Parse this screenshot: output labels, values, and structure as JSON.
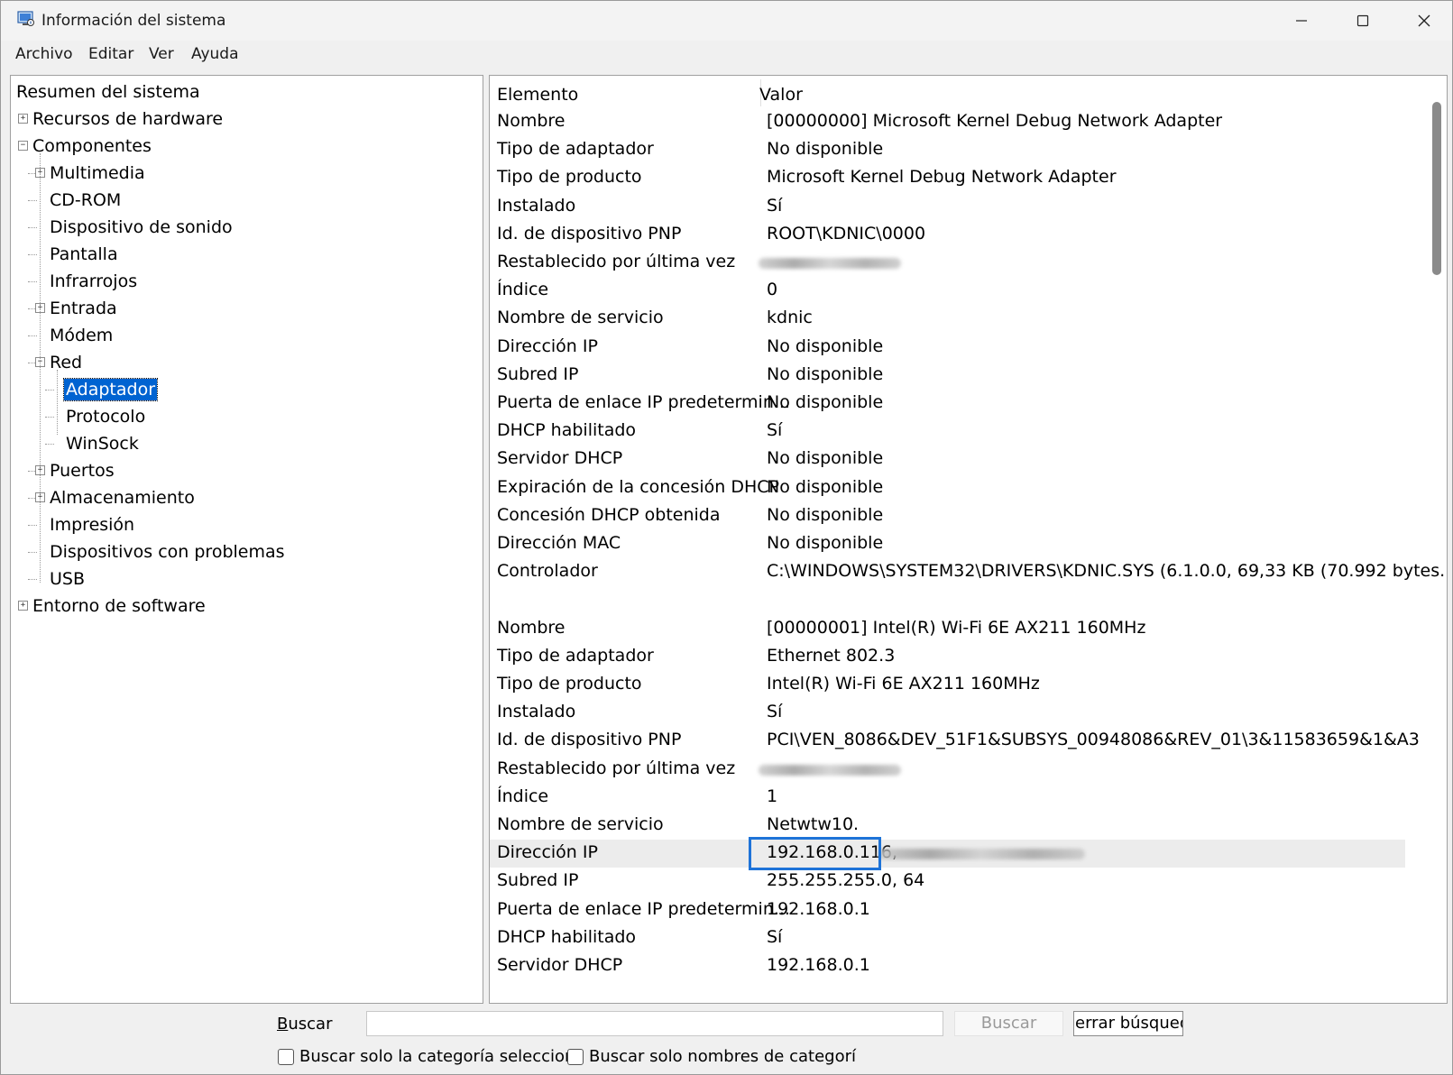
{
  "window": {
    "title": "Información del sistema"
  },
  "menu": [
    "Archivo",
    "Editar",
    "Ver",
    "Ayuda"
  ],
  "tree": {
    "items": [
      {
        "label": "Resumen del sistema",
        "level": 0,
        "expander": "none"
      },
      {
        "label": "Recursos de hardware",
        "level": 0,
        "expander": "plus"
      },
      {
        "label": "Componentes",
        "level": 0,
        "expander": "minus"
      },
      {
        "label": "Multimedia",
        "level": 1,
        "expander": "plus"
      },
      {
        "label": "CD-ROM",
        "level": 1,
        "expander": "none"
      },
      {
        "label": "Dispositivo de sonido",
        "level": 1,
        "expander": "none"
      },
      {
        "label": "Pantalla",
        "level": 1,
        "expander": "none"
      },
      {
        "label": "Infrarrojos",
        "level": 1,
        "expander": "none"
      },
      {
        "label": "Entrada",
        "level": 1,
        "expander": "plus"
      },
      {
        "label": "Módem",
        "level": 1,
        "expander": "none"
      },
      {
        "label": "Red",
        "level": 1,
        "expander": "minus"
      },
      {
        "label": "Adaptador",
        "level": 2,
        "expander": "none",
        "selected": true
      },
      {
        "label": "Protocolo",
        "level": 2,
        "expander": "none"
      },
      {
        "label": "WinSock",
        "level": 2,
        "expander": "none"
      },
      {
        "label": "Puertos",
        "level": 1,
        "expander": "plus"
      },
      {
        "label": "Almacenamiento",
        "level": 1,
        "expander": "plus"
      },
      {
        "label": "Impresión",
        "level": 1,
        "expander": "none"
      },
      {
        "label": "Dispositivos con problemas",
        "level": 1,
        "expander": "none"
      },
      {
        "label": "USB",
        "level": 1,
        "expander": "none"
      },
      {
        "label": "Entorno de software",
        "level": 0,
        "expander": "plus"
      }
    ]
  },
  "list": {
    "headers": {
      "key": "Elemento",
      "value": "Valor"
    },
    "rows": [
      {
        "k": "Nombre",
        "v": "[00000000] Microsoft Kernel Debug Network Adapter"
      },
      {
        "k": "Tipo de adaptador",
        "v": "No disponible"
      },
      {
        "k": "Tipo de producto",
        "v": "Microsoft Kernel Debug Network Adapter"
      },
      {
        "k": "Instalado",
        "v": "Sí"
      },
      {
        "k": "Id. de dispositivo PNP",
        "v": "ROOT\\KDNIC\\0000"
      },
      {
        "k": "Restablecido por última vez",
        "v": "",
        "redacted": true
      },
      {
        "k": "Índice",
        "v": "0"
      },
      {
        "k": "Nombre de servicio",
        "v": "kdnic"
      },
      {
        "k": "Dirección IP",
        "v": "No disponible"
      },
      {
        "k": "Subred IP",
        "v": "No disponible"
      },
      {
        "k": "Puerta de enlace IP predetermin...",
        "v": "No disponible"
      },
      {
        "k": "DHCP habilitado",
        "v": "Sí"
      },
      {
        "k": "Servidor DHCP",
        "v": "No disponible"
      },
      {
        "k": "Expiración de la concesión DHCP",
        "v": "No disponible"
      },
      {
        "k": "Concesión DHCP obtenida",
        "v": "No disponible"
      },
      {
        "k": "Dirección MAC",
        "v": "No disponible"
      },
      {
        "k": "Controlador",
        "v": "C:\\WINDOWS\\SYSTEM32\\DRIVERS\\KDNIC.SYS (6.1.0.0, 69,33 KB (70.992 bytes..."
      },
      {
        "k": "",
        "v": ""
      },
      {
        "k": "Nombre",
        "v": "[00000001] Intel(R) Wi-Fi 6E AX211 160MHz"
      },
      {
        "k": "Tipo de adaptador",
        "v": "Ethernet 802.3"
      },
      {
        "k": "Tipo de producto",
        "v": "Intel(R) Wi-Fi 6E AX211 160MHz"
      },
      {
        "k": "Instalado",
        "v": "Sí"
      },
      {
        "k": "Id. de dispositivo PNP",
        "v": "PCI\\VEN_8086&DEV_51F1&SUBSYS_00948086&REV_01\\3&11583659&1&A3"
      },
      {
        "k": "Restablecido por última vez",
        "v": "",
        "redacted": true
      },
      {
        "k": "Índice",
        "v": "1"
      },
      {
        "k": "Nombre de servicio",
        "v": "Netwtw10."
      },
      {
        "k": "Dirección IP",
        "v": "192.168.0.116,",
        "redacted_tail": true,
        "highlight": true,
        "boxed": true
      },
      {
        "k": "Subred IP",
        "v": "255.255.255.0, 64"
      },
      {
        "k": "Puerta de enlace IP predetermin...",
        "v": "192.168.0.1"
      },
      {
        "k": "DHCP habilitado",
        "v": "Sí"
      },
      {
        "k": "Servidor DHCP",
        "v": "192.168.0.1"
      }
    ]
  },
  "search": {
    "label_prefix": "",
    "label_underlined": "B",
    "label_rest": "uscar",
    "input_value": "",
    "find_button": "Buscar",
    "close_button": "errar búsqued",
    "checkbox1": "Buscar solo la categoría seleccion",
    "checkbox2": "Buscar solo nombres de categorí"
  },
  "colors": {
    "selection": "#0063d1",
    "highlight_box": "#1e73d8"
  }
}
